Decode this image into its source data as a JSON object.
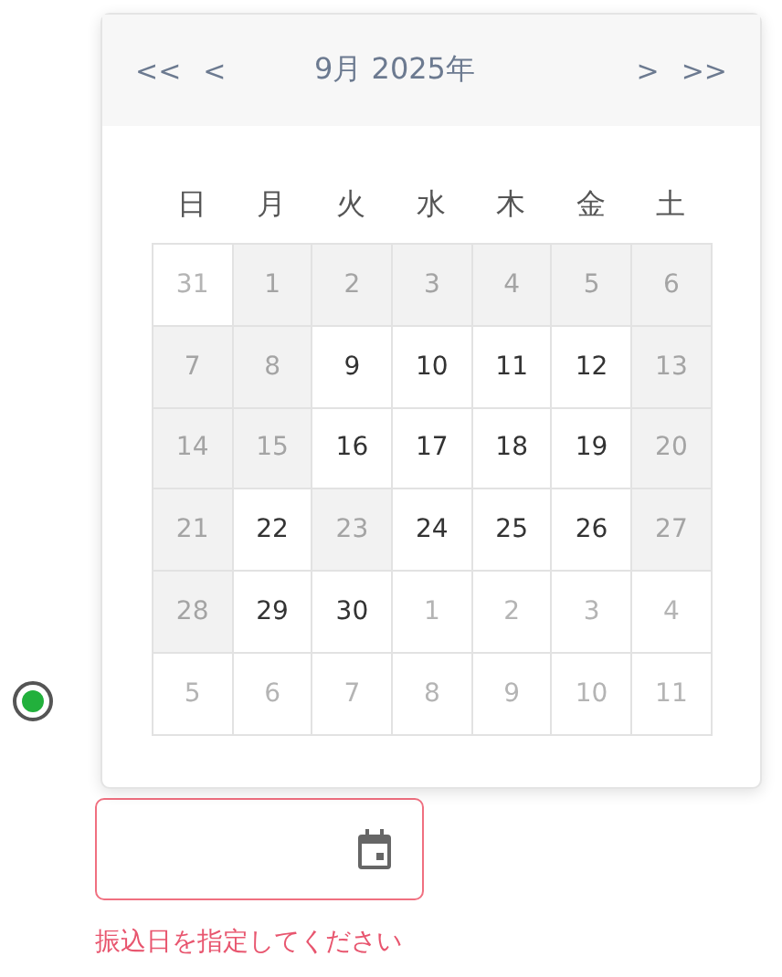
{
  "radio": {
    "selected": true
  },
  "calendar": {
    "nav": {
      "prev_year": "<<",
      "prev_month": "<",
      "title": "9月  2025年",
      "next_month": ">",
      "next_year": ">>"
    },
    "weekdays": [
      "日",
      "月",
      "火",
      "水",
      "木",
      "金",
      "土"
    ],
    "weeks": [
      [
        {
          "day": "31",
          "kind": "outside"
        },
        {
          "day": "1",
          "kind": "disabled"
        },
        {
          "day": "2",
          "kind": "disabled"
        },
        {
          "day": "3",
          "kind": "disabled"
        },
        {
          "day": "4",
          "kind": "disabled"
        },
        {
          "day": "5",
          "kind": "disabled"
        },
        {
          "day": "6",
          "kind": "disabled"
        }
      ],
      [
        {
          "day": "7",
          "kind": "disabled"
        },
        {
          "day": "8",
          "kind": "disabled"
        },
        {
          "day": "9",
          "kind": "available"
        },
        {
          "day": "10",
          "kind": "available"
        },
        {
          "day": "11",
          "kind": "available"
        },
        {
          "day": "12",
          "kind": "available"
        },
        {
          "day": "13",
          "kind": "disabled"
        }
      ],
      [
        {
          "day": "14",
          "kind": "disabled"
        },
        {
          "day": "15",
          "kind": "disabled"
        },
        {
          "day": "16",
          "kind": "available"
        },
        {
          "day": "17",
          "kind": "available"
        },
        {
          "day": "18",
          "kind": "available"
        },
        {
          "day": "19",
          "kind": "available"
        },
        {
          "day": "20",
          "kind": "disabled"
        }
      ],
      [
        {
          "day": "21",
          "kind": "disabled"
        },
        {
          "day": "22",
          "kind": "available"
        },
        {
          "day": "23",
          "kind": "disabled"
        },
        {
          "day": "24",
          "kind": "available"
        },
        {
          "day": "25",
          "kind": "available"
        },
        {
          "day": "26",
          "kind": "available"
        },
        {
          "day": "27",
          "kind": "disabled"
        }
      ],
      [
        {
          "day": "28",
          "kind": "disabled"
        },
        {
          "day": "29",
          "kind": "available"
        },
        {
          "day": "30",
          "kind": "available"
        },
        {
          "day": "1",
          "kind": "outside"
        },
        {
          "day": "2",
          "kind": "outside"
        },
        {
          "day": "3",
          "kind": "outside"
        },
        {
          "day": "4",
          "kind": "outside"
        }
      ],
      [
        {
          "day": "5",
          "kind": "outside"
        },
        {
          "day": "6",
          "kind": "outside"
        },
        {
          "day": "7",
          "kind": "outside"
        },
        {
          "day": "8",
          "kind": "outside"
        },
        {
          "day": "9",
          "kind": "outside"
        },
        {
          "day": "10",
          "kind": "outside"
        },
        {
          "day": "11",
          "kind": "outside"
        }
      ]
    ]
  },
  "date_field": {
    "invalid": true,
    "error": "振込日を指定してください"
  }
}
